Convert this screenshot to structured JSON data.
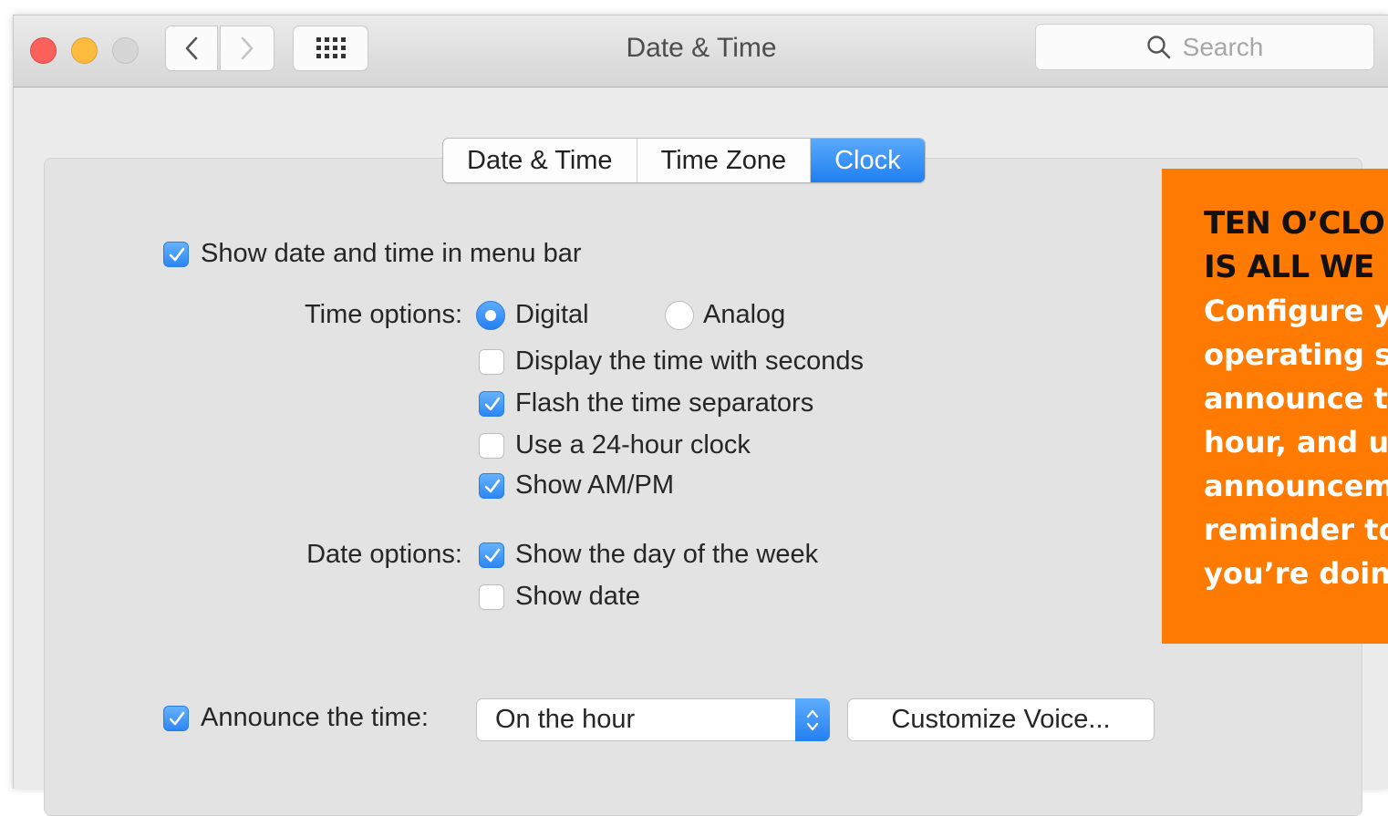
{
  "window": {
    "title": "Date & Time",
    "search_placeholder": "Search"
  },
  "tabs": [
    {
      "label": "Date & Time",
      "active": false
    },
    {
      "label": "Time Zone",
      "active": false
    },
    {
      "label": "Clock",
      "active": true
    }
  ],
  "clock": {
    "show_menu_bar": {
      "label": "Show date and time in menu bar",
      "checked": true
    },
    "time_options": {
      "label": "Time options:",
      "digital": {
        "label": "Digital",
        "selected": true
      },
      "analog": {
        "label": "Analog",
        "selected": false
      },
      "seconds": {
        "label": "Display the time with seconds",
        "checked": false
      },
      "flash": {
        "label": "Flash the time separators",
        "checked": true
      },
      "h24": {
        "label": "Use a 24-hour clock",
        "checked": false
      },
      "ampm": {
        "label": "Show AM/PM",
        "checked": true
      }
    },
    "date_options": {
      "label": "Date options:",
      "weekday": {
        "label": "Show the day of the week",
        "checked": true
      },
      "date": {
        "label": "Show date",
        "checked": false
      }
    },
    "announce": {
      "label": "Announce the time:",
      "checked": true,
      "selected": "On the hour",
      "customize_label": "Customize Voice..."
    }
  },
  "callout": {
    "heading": [
      "TEN O’CLO",
      "IS ALL WE"
    ],
    "body": [
      "Configure y",
      "operating s",
      "announce t",
      "hour, and us",
      "announcem",
      "reminder to",
      "you’re doing"
    ],
    "color": "#ff7a00"
  }
}
